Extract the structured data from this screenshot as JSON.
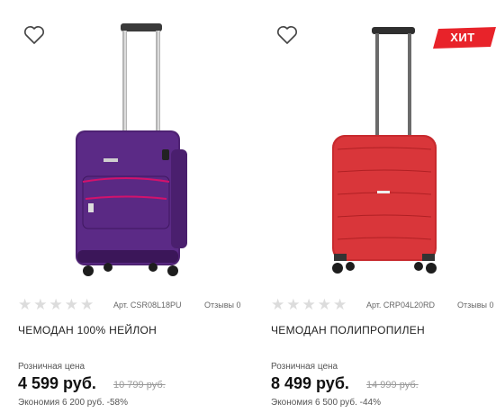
{
  "products": [
    {
      "article": "Арт. CSR08L18PU",
      "reviews": "Отзывы 0",
      "title": "ЧЕМОДАН 100% НЕЙЛОН",
      "price_label": "Розничная цена",
      "price": "4 599 руб.",
      "old_price": "10 799 руб.",
      "economy": "Экономия 6 200 руб. -58%",
      "rating_stars": 0,
      "color": "#5b2a86"
    },
    {
      "badge": "ХИТ",
      "article": "Арт. CRP04L20RD",
      "reviews": "Отзывы 0",
      "title": "ЧЕМОДАН ПОЛИПРОПИЛЕН",
      "price_label": "Розничная цена",
      "price": "8 499 руб.",
      "old_price": "14 999 руб.",
      "economy": "Экономия 6 500 руб. -44%",
      "rating_stars": 0,
      "color": "#d9363a"
    }
  ],
  "colors": {
    "badge": "#e8232a",
    "star_empty": "#dcdcdc"
  },
  "icons": {
    "favorite": "heart-outline-icon",
    "rating": "star-icon"
  }
}
